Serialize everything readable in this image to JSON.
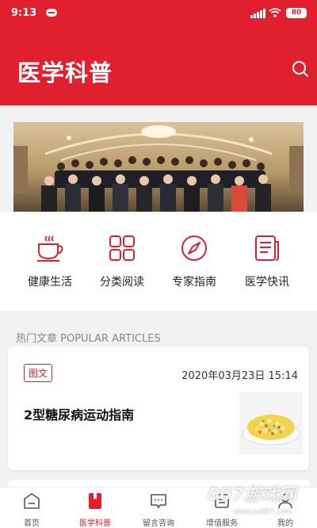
{
  "status_bar": {
    "time": "9:13",
    "battery": "80"
  },
  "header": {
    "title": "医学科普"
  },
  "categories": [
    {
      "label": "健康生活",
      "icon": "coffee-cup-icon"
    },
    {
      "label": "分类阅读",
      "icon": "grid-icon"
    },
    {
      "label": "专家指南",
      "icon": "compass-icon"
    },
    {
      "label": "医学快讯",
      "icon": "news-icon"
    }
  ],
  "section": {
    "title": "热门文章 POPULAR ARTICLES"
  },
  "article": {
    "tag": "图文",
    "date": "2020年03月23日 15:14",
    "title": "2型糖尿病运动指南"
  },
  "tabs": [
    {
      "label": "首页",
      "icon": "home-icon"
    },
    {
      "label": "医学科普",
      "icon": "bookmark-icon",
      "active": true
    },
    {
      "label": "留言咨询",
      "icon": "message-icon"
    },
    {
      "label": "增值服务",
      "icon": "service-icon"
    },
    {
      "label": "我的",
      "icon": "user-icon"
    }
  ],
  "watermark": {
    "text": "007游戏网",
    "url": "www.yx007.com"
  },
  "colors": {
    "brand": "#e0202e"
  }
}
